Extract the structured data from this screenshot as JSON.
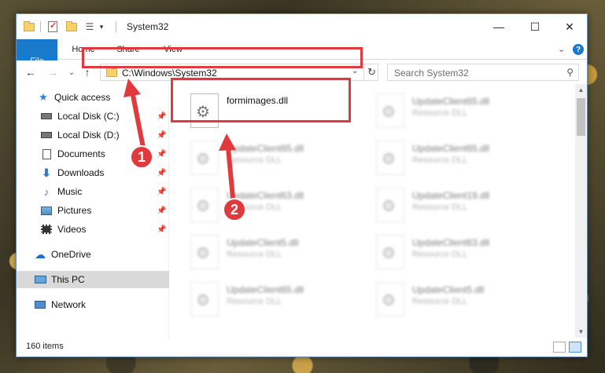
{
  "window": {
    "title": "System32",
    "minimize": "—",
    "maximize": "☐",
    "close": "✕"
  },
  "ribbon": {
    "tabs": [
      "File",
      "Home",
      "Share",
      "View"
    ],
    "expand": "⌄"
  },
  "nav": {
    "back": "←",
    "forward": "→",
    "recent": "⌄",
    "up": "↑"
  },
  "address": {
    "path": "C:\\Windows\\System32",
    "dropdown": "⌄",
    "refresh": "↻"
  },
  "search": {
    "placeholder": "Search System32"
  },
  "sidebar": {
    "items": [
      {
        "label": "Quick access",
        "icon": "star-icon"
      },
      {
        "label": "Local Disk (C:)",
        "icon": "drive-icon",
        "pinned": true
      },
      {
        "label": "Local Disk (D:)",
        "icon": "drive-icon",
        "pinned": true
      },
      {
        "label": "Documents",
        "icon": "documents-icon",
        "pinned": true
      },
      {
        "label": "Downloads",
        "icon": "downloads-icon",
        "pinned": true
      },
      {
        "label": "Music",
        "icon": "music-icon",
        "pinned": true
      },
      {
        "label": "Pictures",
        "icon": "pictures-icon",
        "pinned": true
      },
      {
        "label": "Videos",
        "icon": "videos-icon",
        "pinned": true
      },
      {
        "label": "OneDrive",
        "icon": "onedrive-icon"
      },
      {
        "label": "This PC",
        "icon": "this-pc-icon",
        "selected": true
      },
      {
        "label": "Network",
        "icon": "network-icon"
      }
    ]
  },
  "files": {
    "highlighted": {
      "name": "formimages.dll"
    },
    "items": [
      {
        "name": "UpdateClient65.dll",
        "type": "Resource DLL"
      },
      {
        "name": "UpdateClient65.dll",
        "type": "Resource DLL"
      },
      {
        "name": "UpdateClient65.dll",
        "type": "Resource DLL"
      },
      {
        "name": "UpdateClient63.dll",
        "type": "Resource DLL"
      },
      {
        "name": "UpdateClient19.dll",
        "type": "Resource DLL"
      },
      {
        "name": "UpdateClient5.dll",
        "type": "Resource DLL"
      },
      {
        "name": "UpdateClient63.dll",
        "type": "Resource DLL"
      },
      {
        "name": "UpdateClient65.dll",
        "type": "Resource DLL"
      },
      {
        "name": "UpdateClient5.dll",
        "type": "Resource DLL"
      }
    ]
  },
  "status": {
    "count": "160 items"
  },
  "callouts": [
    "1",
    "2"
  ],
  "colors": {
    "accent": "#1979ca",
    "highlight": "#e03a3e"
  }
}
